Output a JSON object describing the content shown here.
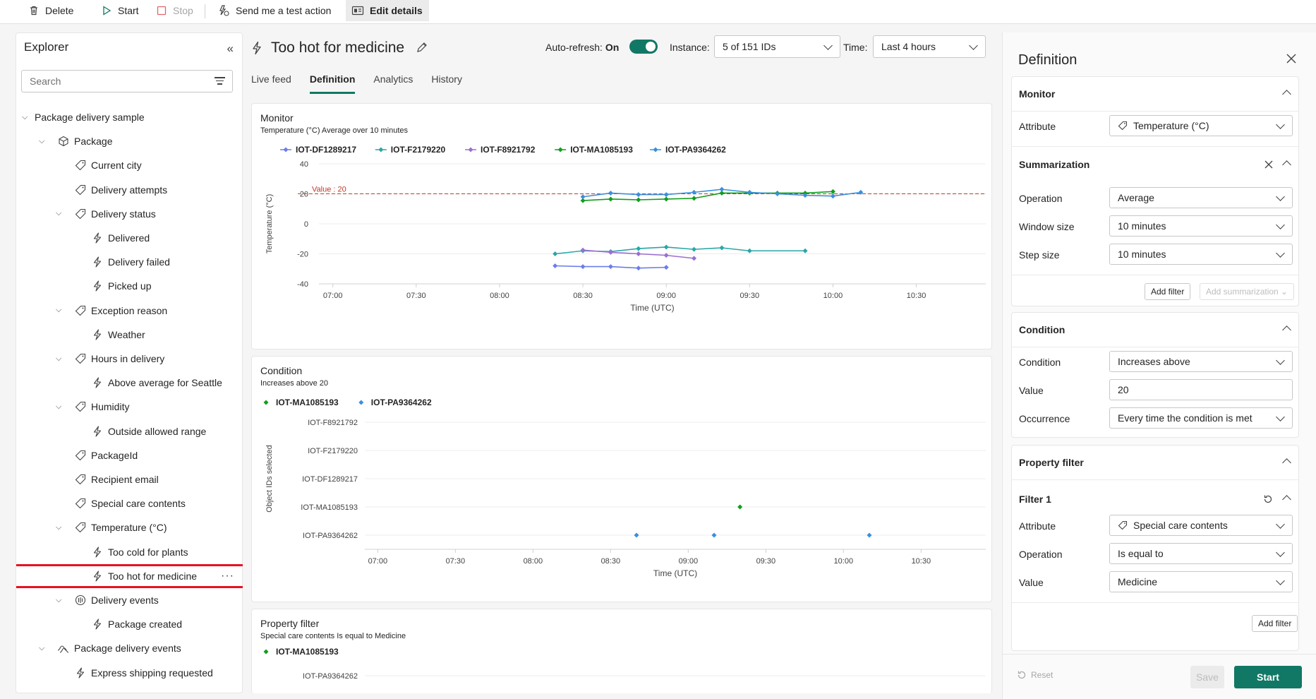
{
  "toolbar": {
    "delete_label": "Delete",
    "start_label": "Start",
    "stop_label": "Stop",
    "test_action_label": "Send me a test action",
    "edit_details_label": "Edit details"
  },
  "explorer": {
    "title": "Explorer",
    "search_placeholder": "Search",
    "items": [
      {
        "label": "Package delivery sample",
        "icon": "chevron"
      },
      {
        "label": "Package",
        "icon": "cube-icon"
      },
      {
        "label": "Current city",
        "icon": "tag-icon"
      },
      {
        "label": "Delivery attempts",
        "icon": "tag-icon"
      },
      {
        "label": "Delivery status",
        "icon": "tag-icon"
      },
      {
        "label": "Delivered",
        "icon": "lightning-icon"
      },
      {
        "label": "Delivery failed",
        "icon": "lightning-icon"
      },
      {
        "label": "Picked up",
        "icon": "lightning-icon"
      },
      {
        "label": "Exception reason",
        "icon": "tag-icon"
      },
      {
        "label": "Weather",
        "icon": "lightning-icon"
      },
      {
        "label": "Hours in delivery",
        "icon": "tag-icon"
      },
      {
        "label": "Above average for Seattle",
        "icon": "lightning-icon"
      },
      {
        "label": "Humidity",
        "icon": "tag-icon"
      },
      {
        "label": "Outside allowed range",
        "icon": "lightning-icon"
      },
      {
        "label": "PackageId",
        "icon": "tag-icon"
      },
      {
        "label": "Recipient email",
        "icon": "tag-icon"
      },
      {
        "label": "Special care contents",
        "icon": "tag-icon"
      },
      {
        "label": "Temperature (°C)",
        "icon": "tag-icon"
      },
      {
        "label": "Too cold for plants",
        "icon": "lightning-icon"
      },
      {
        "label": "Too hot for medicine",
        "icon": "lightning-icon",
        "selected": true
      },
      {
        "label": "Delivery events",
        "icon": "event-icon"
      },
      {
        "label": "Package created",
        "icon": "lightning-icon"
      },
      {
        "label": "Package delivery events",
        "icon": "stream-icon"
      },
      {
        "label": "Express shipping requested",
        "icon": "lightning-icon"
      }
    ]
  },
  "center": {
    "title": "Too hot for medicine",
    "auto_refresh_label": "Auto-refresh:",
    "auto_refresh_value": "On",
    "instance_label": "Instance:",
    "instance_value": "5 of 151 IDs",
    "time_label": "Time:",
    "time_value": "Last 4 hours",
    "tabs": [
      "Live feed",
      "Definition",
      "Analytics",
      "History"
    ],
    "active_tab": "Definition",
    "monitor_card": {
      "title": "Monitor",
      "subtitle": "Temperature (°C) Average over 10 minutes"
    },
    "condition_card": {
      "title": "Condition",
      "subtitle": "Increases above 20"
    },
    "property_card": {
      "title": "Property filter",
      "subtitle": "Special care contents Is equal to Medicine"
    }
  },
  "chart_data": [
    {
      "type": "line",
      "title": "Monitor",
      "xlabel": "Time (UTC)",
      "ylabel": "Temperature (°C)",
      "ylim": [
        -40,
        40
      ],
      "yticks": [
        40,
        20,
        0,
        -20,
        -40
      ],
      "xlim": [
        "06:55",
        "10:55"
      ],
      "xticks": [
        "07:00",
        "07:30",
        "08:00",
        "08:30",
        "09:00",
        "09:30",
        "10:00",
        "10:30"
      ],
      "grid": true,
      "legend": "top-left",
      "threshold": {
        "value": 20,
        "label": "Value : 20"
      },
      "series": [
        {
          "name": "IOT-DF1289217",
          "color": "#6b7ee8",
          "points": [
            [
              "08:20",
              -28
            ],
            [
              "08:30",
              -28.5
            ],
            [
              "08:40",
              -28.5
            ],
            [
              "08:50",
              -29.5
            ],
            [
              "09:00",
              -29
            ]
          ]
        },
        {
          "name": "IOT-F2179220",
          "color": "#2ba6a6",
          "points": [
            [
              "08:20",
              -20
            ],
            [
              "08:30",
              -18
            ],
            [
              "08:40",
              -18.5
            ],
            [
              "08:50",
              -16.5
            ],
            [
              "09:00",
              -15.5
            ],
            [
              "09:10",
              -17
            ],
            [
              "09:20",
              -16
            ],
            [
              "09:30",
              -18
            ],
            [
              "09:50",
              -18
            ]
          ]
        },
        {
          "name": "IOT-F8921792",
          "color": "#9b6fd0",
          "points": [
            [
              "08:30",
              -17.5
            ],
            [
              "08:40",
              -19
            ],
            [
              "08:50",
              -20
            ],
            [
              "09:00",
              -21
            ],
            [
              "09:10",
              -23
            ]
          ]
        },
        {
          "name": "IOT-MA1085193",
          "color": "#119e1c",
          "points": [
            [
              "08:30",
              15.5
            ],
            [
              "08:40",
              16.5
            ],
            [
              "08:50",
              16
            ],
            [
              "09:00",
              16.5
            ],
            [
              "09:10",
              17
            ],
            [
              "09:20",
              20.5
            ],
            [
              "09:30",
              20.5
            ],
            [
              "09:40",
              20.5
            ],
            [
              "09:50",
              20.5
            ],
            [
              "10:00",
              21.5
            ]
          ]
        },
        {
          "name": "IOT-PA9364262",
          "color": "#3a8fdd",
          "points": [
            [
              "08:30",
              18
            ],
            [
              "08:40",
              20.5
            ],
            [
              "08:50",
              19.5
            ],
            [
              "09:00",
              19.5
            ],
            [
              "09:10",
              21
            ],
            [
              "09:20",
              23
            ],
            [
              "09:30",
              21
            ],
            [
              "09:40",
              20
            ],
            [
              "09:50",
              19
            ],
            [
              "10:00",
              18.5
            ],
            [
              "10:10",
              21
            ]
          ]
        }
      ]
    },
    {
      "type": "scatter",
      "title": "Condition",
      "xlabel": "Time (UTC)",
      "ylabel": "Object IDs selected",
      "xlim": [
        "06:55",
        "10:55"
      ],
      "xticks": [
        "07:00",
        "07:30",
        "08:00",
        "08:30",
        "09:00",
        "09:30",
        "10:00",
        "10:30"
      ],
      "categories": [
        "IOT-F8921792",
        "IOT-F2179220",
        "IOT-DF1289217",
        "IOT-MA1085193",
        "IOT-PA9364262"
      ],
      "grid": true,
      "legend": "top-left",
      "series": [
        {
          "name": "IOT-MA1085193",
          "color": "#119e1c",
          "points": [
            [
              "09:20",
              "IOT-MA1085193"
            ]
          ]
        },
        {
          "name": "IOT-PA9364262",
          "color": "#3a8fdd",
          "points": [
            [
              "08:40",
              "IOT-PA9364262"
            ],
            [
              "09:10",
              "IOT-PA9364262"
            ],
            [
              "10:10",
              "IOT-PA9364262"
            ]
          ]
        }
      ]
    },
    {
      "type": "scatter",
      "title": "Property filter",
      "categories": [
        "IOT-PA9364262"
      ],
      "legend": "top-left",
      "series": [
        {
          "name": "IOT-MA1085193",
          "color": "#119e1c",
          "points": []
        }
      ]
    }
  ],
  "definition": {
    "title": "Definition",
    "monitor": {
      "title": "Monitor",
      "attribute_label": "Attribute",
      "attribute_value": "Temperature (°C)"
    },
    "summarization": {
      "title": "Summarization",
      "operation_label": "Operation",
      "operation_value": "Average",
      "window_label": "Window size",
      "window_value": "10 minutes",
      "step_label": "Step size",
      "step_value": "10 minutes",
      "add_filter": "Add filter",
      "add_summarization": "Add summarization"
    },
    "condition": {
      "title": "Condition",
      "condition_label": "Condition",
      "condition_value": "Increases above",
      "value_label": "Value",
      "value_value": "20",
      "occurrence_label": "Occurrence",
      "occurrence_value": "Every time the condition is met"
    },
    "property_filter": {
      "title": "Property filter",
      "filter_title": "Filter 1",
      "attribute_label": "Attribute",
      "attribute_value": "Special care contents",
      "operation_label": "Operation",
      "operation_value": "Is equal to",
      "value_label": "Value",
      "value_value": "Medicine",
      "add_filter": "Add filter"
    },
    "footer": {
      "reset": "Reset",
      "save": "Save",
      "start": "Start"
    }
  },
  "colors": {
    "accent": "#117865",
    "threshold": "#c0392b",
    "selection": "#e81123"
  }
}
